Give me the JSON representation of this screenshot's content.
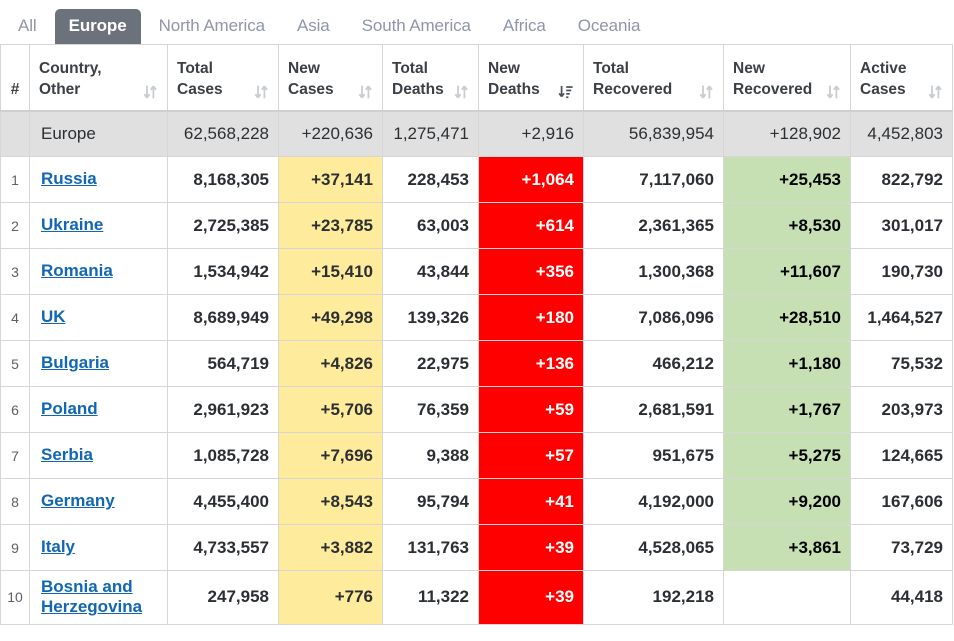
{
  "tabs": [
    {
      "label": "All",
      "active": false
    },
    {
      "label": "Europe",
      "active": true
    },
    {
      "label": "North America",
      "active": false
    },
    {
      "label": "Asia",
      "active": false
    },
    {
      "label": "South America",
      "active": false
    },
    {
      "label": "Africa",
      "active": false
    },
    {
      "label": "Oceania",
      "active": false
    }
  ],
  "columns": [
    {
      "key": "index",
      "label": "#",
      "sort": "none"
    },
    {
      "key": "country",
      "label": "Country, Other",
      "sort": "both"
    },
    {
      "key": "total_cases",
      "label": "Total Cases",
      "sort": "both"
    },
    {
      "key": "new_cases",
      "label": "New Cases",
      "sort": "both"
    },
    {
      "key": "total_deaths",
      "label": "Total Deaths",
      "sort": "both"
    },
    {
      "key": "new_deaths",
      "label": "New Deaths",
      "sort": "desc"
    },
    {
      "key": "total_recovered",
      "label": "Total Recovered",
      "sort": "both"
    },
    {
      "key": "new_recovered",
      "label": "New Recovered",
      "sort": "both"
    },
    {
      "key": "active_cases",
      "label": "Active Cases",
      "sort": "both"
    }
  ],
  "summary_row": {
    "index": "",
    "country": "Europe",
    "total_cases": "62,568,228",
    "new_cases": "+220,636",
    "total_deaths": "1,275,471",
    "new_deaths": "+2,916",
    "total_recovered": "56,839,954",
    "new_recovered": "+128,902",
    "active_cases": "4,452,803"
  },
  "rows": [
    {
      "index": "1",
      "country": "Russia",
      "total_cases": "8,168,305",
      "new_cases": "+37,141",
      "total_deaths": "228,453",
      "new_deaths": "+1,064",
      "total_recovered": "7,117,060",
      "new_recovered": "+25,453",
      "active_cases": "822,792"
    },
    {
      "index": "2",
      "country": "Ukraine",
      "total_cases": "2,725,385",
      "new_cases": "+23,785",
      "total_deaths": "63,003",
      "new_deaths": "+614",
      "total_recovered": "2,361,365",
      "new_recovered": "+8,530",
      "active_cases": "301,017"
    },
    {
      "index": "3",
      "country": "Romania",
      "total_cases": "1,534,942",
      "new_cases": "+15,410",
      "total_deaths": "43,844",
      "new_deaths": "+356",
      "total_recovered": "1,300,368",
      "new_recovered": "+11,607",
      "active_cases": "190,730"
    },
    {
      "index": "4",
      "country": "UK",
      "total_cases": "8,689,949",
      "new_cases": "+49,298",
      "total_deaths": "139,326",
      "new_deaths": "+180",
      "total_recovered": "7,086,096",
      "new_recovered": "+28,510",
      "active_cases": "1,464,527"
    },
    {
      "index": "5",
      "country": "Bulgaria",
      "total_cases": "564,719",
      "new_cases": "+4,826",
      "total_deaths": "22,975",
      "new_deaths": "+136",
      "total_recovered": "466,212",
      "new_recovered": "+1,180",
      "active_cases": "75,532"
    },
    {
      "index": "6",
      "country": "Poland",
      "total_cases": "2,961,923",
      "new_cases": "+5,706",
      "total_deaths": "76,359",
      "new_deaths": "+59",
      "total_recovered": "2,681,591",
      "new_recovered": "+1,767",
      "active_cases": "203,973"
    },
    {
      "index": "7",
      "country": "Serbia",
      "total_cases": "1,085,728",
      "new_cases": "+7,696",
      "total_deaths": "9,388",
      "new_deaths": "+57",
      "total_recovered": "951,675",
      "new_recovered": "+5,275",
      "active_cases": "124,665"
    },
    {
      "index": "8",
      "country": "Germany",
      "total_cases": "4,455,400",
      "new_cases": "+8,543",
      "total_deaths": "95,794",
      "new_deaths": "+41",
      "total_recovered": "4,192,000",
      "new_recovered": "+9,200",
      "active_cases": "167,606"
    },
    {
      "index": "9",
      "country": "Italy",
      "total_cases": "4,733,557",
      "new_cases": "+3,882",
      "total_deaths": "131,763",
      "new_deaths": "+39",
      "total_recovered": "4,528,065",
      "new_recovered": "+3,861",
      "active_cases": "73,729"
    },
    {
      "index": "10",
      "country": "Bosnia and Herzegovina",
      "total_cases": "247,958",
      "new_cases": "+776",
      "total_deaths": "11,322",
      "new_deaths": "+39",
      "total_recovered": "192,218",
      "new_recovered": "",
      "active_cases": "44,418"
    }
  ],
  "colors": {
    "active_tab_bg": "#6b727c",
    "tab_text": "#8f95ac",
    "new_cases_bg": "#ffeb9c",
    "new_deaths_bg": "#ff0000",
    "new_recovered_bg": "#c6e0b4",
    "summary_row_bg": "#e0e0e0",
    "link": "#1267b5"
  },
  "icons": {
    "sort_both": "sort-both-icon",
    "sort_desc": "sort-descending-icon"
  }
}
